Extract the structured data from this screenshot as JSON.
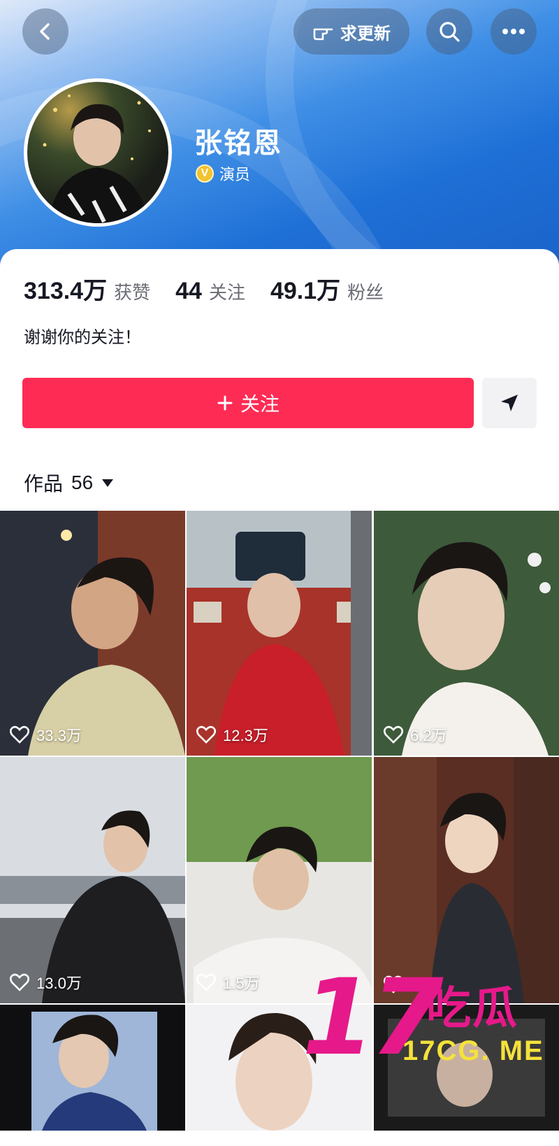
{
  "header": {
    "request_update_label": "求更新",
    "name": "张铭恩",
    "verified_title": "演员",
    "badge_letter": "V"
  },
  "stats": [
    {
      "value": "313.4万",
      "label": "获赞"
    },
    {
      "value": "44",
      "label": "关注"
    },
    {
      "value": "49.1万",
      "label": "粉丝"
    }
  ],
  "bio": "谢谢你的关注！",
  "follow_label": "关注",
  "works": {
    "label": "作品",
    "count": "56"
  },
  "videos": [
    {
      "likes": "33.3万"
    },
    {
      "likes": "12.3万"
    },
    {
      "likes": "6.2万"
    },
    {
      "likes": "13.0万"
    },
    {
      "likes": "1.5万"
    },
    {
      "likes": "3."
    },
    {
      "likes": ""
    },
    {
      "likes": ""
    },
    {
      "likes": ""
    }
  ],
  "watermark": {
    "number": "17",
    "chinese": "吃瓜",
    "url": "17CG. ME"
  },
  "colors": {
    "accent": "#fe2c55",
    "header_blue": "#1e6fd6",
    "verified_gold": "#f2c230"
  },
  "icons": {
    "back": "back-icon",
    "request": "hand-point-icon",
    "search": "search-icon",
    "more": "more-icon",
    "share": "send-icon",
    "like": "heart-icon",
    "dropdown": "caret-down-icon"
  }
}
